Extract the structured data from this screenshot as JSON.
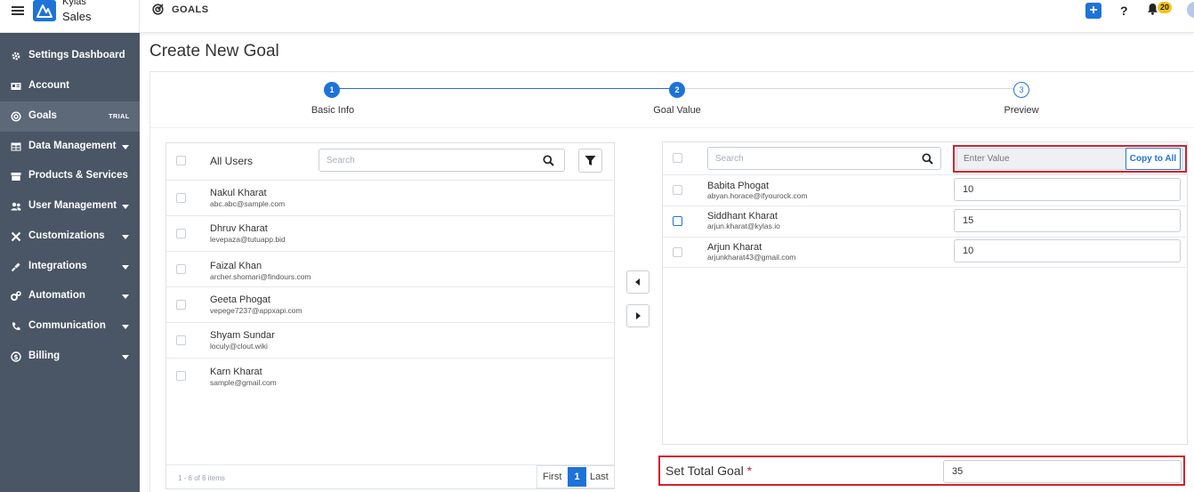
{
  "header": {
    "brand_top": "Kylas",
    "brand_name": "Sales",
    "title": "GOALS",
    "notification_count": "20",
    "help_label": "?"
  },
  "sidebar": {
    "items": [
      {
        "label": "Settings Dashboard",
        "icon": "gear-icon"
      },
      {
        "label": "Account",
        "icon": "id-card-icon"
      },
      {
        "label": "Goals",
        "icon": "target-icon",
        "badge": "TRIAL",
        "active": true
      },
      {
        "label": "Data Management",
        "icon": "table-icon",
        "expandable": true
      },
      {
        "label": "Products & Services",
        "icon": "box-icon"
      },
      {
        "label": "User Management",
        "icon": "users-icon",
        "expandable": true
      },
      {
        "label": "Customizations",
        "icon": "tools-icon",
        "expandable": true
      },
      {
        "label": "Integrations",
        "icon": "plug-icon",
        "expandable": true
      },
      {
        "label": "Automation",
        "icon": "cogs-icon",
        "expandable": true
      },
      {
        "label": "Communication",
        "icon": "phone-icon",
        "expandable": true
      },
      {
        "label": "Billing",
        "icon": "dollar-icon",
        "expandable": true
      }
    ]
  },
  "page": {
    "title": "Create New Goal"
  },
  "stepper": {
    "steps": [
      {
        "number": "1",
        "label": "Basic Info",
        "state": "done"
      },
      {
        "number": "2",
        "label": "Goal Value",
        "state": "current"
      },
      {
        "number": "3",
        "label": "Preview",
        "state": "todo"
      }
    ]
  },
  "available_users": {
    "header_label": "All Users",
    "search_placeholder": "Search",
    "users": [
      {
        "name": "Nakul Kharat",
        "email": "abc.abc@sample.com"
      },
      {
        "name": "Dhruv Kharat",
        "email": "levepaza@tutuapp.bid"
      },
      {
        "name": "Faizal Khan",
        "email": "archer.shomari@findours.com"
      },
      {
        "name": "Geeta Phogat",
        "email": "vepege7237@appxapi.com"
      },
      {
        "name": "Shyam Sundar",
        "email": "loculy@clout.wiki"
      },
      {
        "name": "Karn Kharat",
        "email": "sample@gmail.com"
      }
    ],
    "footer_count": "1 - 6 of 6 items",
    "pager": {
      "first": "First",
      "current": "1",
      "last": "Last"
    }
  },
  "selected_users": {
    "search_placeholder": "Search",
    "value_placeholder": "Enter Value",
    "copy_all_label": "Copy to All",
    "users": [
      {
        "name": "Babita Phogat",
        "email": "abyan.horace@ifyourock.com",
        "value": "10",
        "checked_style": "plain"
      },
      {
        "name": "Siddhant Kharat",
        "email": "arjun.kharat@kylas.io",
        "value": "15",
        "checked_style": "focus"
      },
      {
        "name": "Arjun Kharat",
        "email": "arjunkharat43@gmail.com",
        "value": "10",
        "checked_style": "plain"
      }
    ]
  },
  "total_goal": {
    "label": "Set Total Goal",
    "required_mark": "*",
    "value": "35"
  },
  "colors": {
    "accent": "#1e73d8",
    "sidebar_bg": "#4a5565",
    "highlight_red": "#d3202e",
    "badge_yellow": "#f5c518"
  }
}
